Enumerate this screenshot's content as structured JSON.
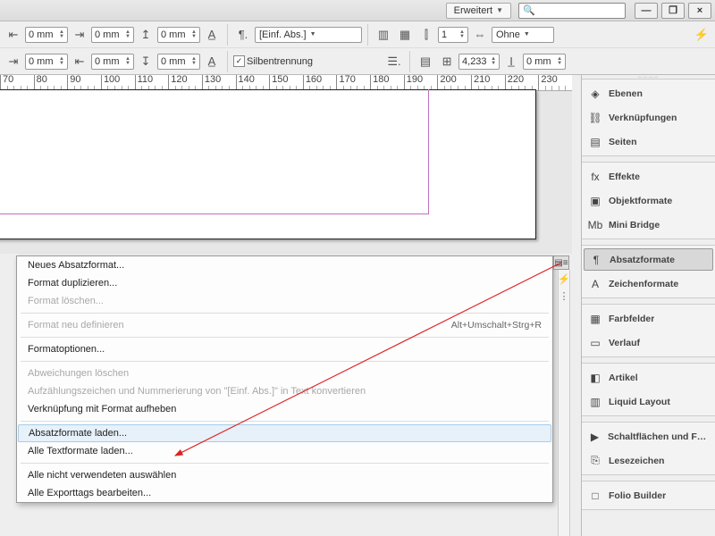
{
  "titlebar": {
    "workspace_label": "Erweitert",
    "search_placeholder": "",
    "min": "—",
    "restore": "❐",
    "close": "×"
  },
  "controls": {
    "zero_mm": "0 mm",
    "para_style": "[Einf. Abs.]",
    "hyphenation_label": "Silbentrennung",
    "columns": "1",
    "align_mode": "Ohne",
    "tracking": "4,233",
    "baseline": "0 mm"
  },
  "ruler": {
    "start": 70,
    "end": 240,
    "step": 10
  },
  "panels": {
    "g1": [
      "Ebenen",
      "Verknüpfungen",
      "Seiten"
    ],
    "g2": [
      "Effekte",
      "Objektformate",
      "Mini Bridge"
    ],
    "g3": [
      "Absatzformate",
      "Zeichenformate"
    ],
    "g4": [
      "Farbfelder",
      "Verlauf"
    ],
    "g5": [
      "Artikel",
      "Liquid Layout"
    ],
    "g6": [
      "Schaltflächen und For…",
      "Lesezeichen"
    ],
    "g7": [
      "Folio Builder"
    ]
  },
  "panel_icons": {
    "Ebenen": "◈",
    "Verknüpfungen": "⛓",
    "Seiten": "▤",
    "Effekte": "fx",
    "Objektformate": "▣",
    "Mini Bridge": "Mb",
    "Absatzformate": "¶",
    "Zeichenformate": "A",
    "Farbfelder": "▦",
    "Verlauf": "▭",
    "Artikel": "◧",
    "Liquid Layout": "▥",
    "Schaltflächen und For…": "▶",
    "Lesezeichen": "⎘",
    "Folio Builder": "□"
  },
  "active_panel": "Absatzformate",
  "menu": [
    {
      "label": "Neues Absatzformat...",
      "enabled": true
    },
    {
      "label": "Format duplizieren...",
      "enabled": true
    },
    {
      "label": "Format löschen...",
      "enabled": false
    },
    {
      "sep": true
    },
    {
      "label": "Format neu definieren",
      "enabled": false,
      "shortcut": "Alt+Umschalt+Strg+R"
    },
    {
      "sep": true
    },
    {
      "label": "Formatoptionen...",
      "enabled": true
    },
    {
      "sep": true
    },
    {
      "label": "Abweichungen löschen",
      "enabled": false
    },
    {
      "label": "Aufzählungszeichen und Nummerierung von \"[Einf. Abs.]\" in Text konvertieren",
      "enabled": false
    },
    {
      "label": "Verknüpfung mit Format aufheben",
      "enabled": true
    },
    {
      "sep": true
    },
    {
      "label": "Absatzformate laden...",
      "enabled": true,
      "highlight": true
    },
    {
      "label": "Alle Textformate laden...",
      "enabled": true
    },
    {
      "sep": true
    },
    {
      "label": "Alle nicht verwendeten auswählen",
      "enabled": true
    },
    {
      "label": "Alle Exporttags bearbeiten...",
      "enabled": true
    }
  ]
}
